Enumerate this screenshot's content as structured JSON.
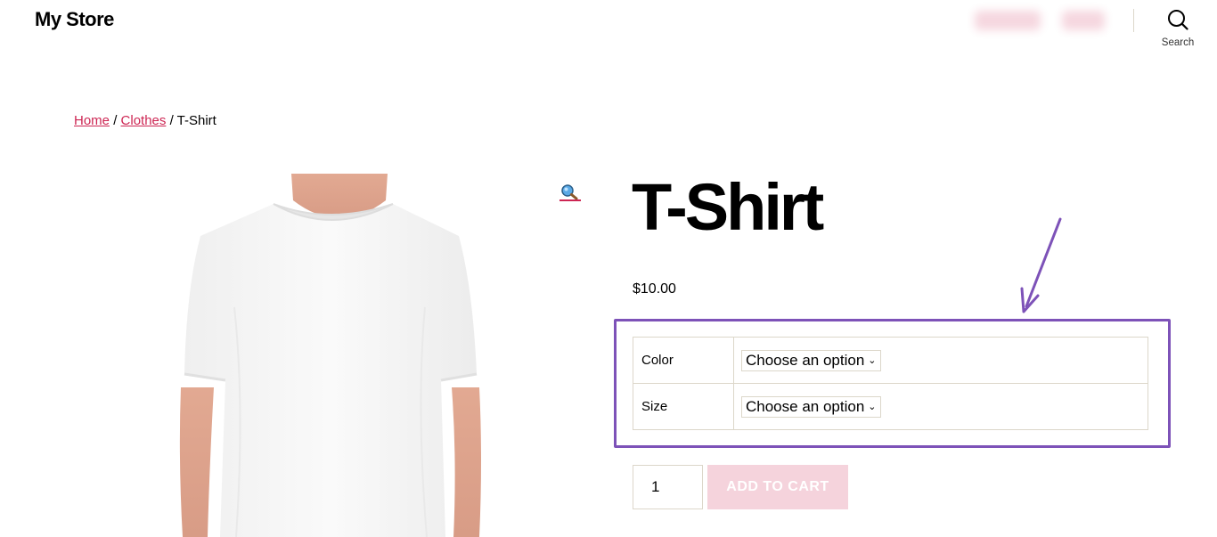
{
  "header": {
    "site_title": "My Store",
    "search_label": "Search"
  },
  "breadcrumb": {
    "items": [
      "Home",
      "Clothes"
    ],
    "separator": "/",
    "current": "T-Shirt"
  },
  "product": {
    "title": "T-Shirt",
    "price": "$10.00",
    "image_icon": "white-tshirt-photo",
    "variations": [
      {
        "label": "Color",
        "placeholder": "Choose an option"
      },
      {
        "label": "Size",
        "placeholder": "Choose an option"
      }
    ],
    "quantity": "1",
    "add_to_cart_label": "ADD TO CART"
  },
  "colors": {
    "accent": "#cd2653",
    "highlight": "#7d52b8",
    "button_disabled": "#f5d3dc",
    "border": "#dcd7ca"
  }
}
